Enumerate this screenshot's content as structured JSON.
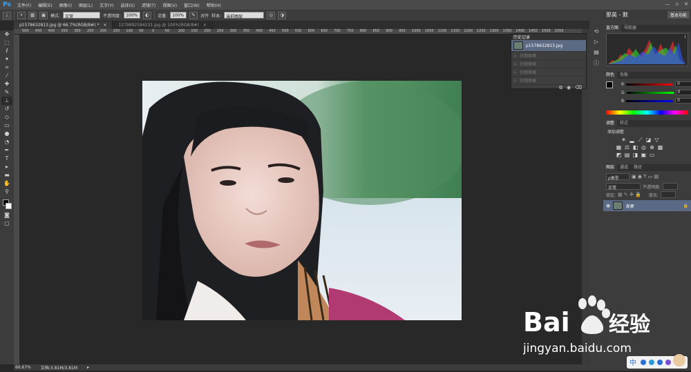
{
  "app": {
    "logo": "Ps"
  },
  "menu": [
    "文件(F)",
    "编辑(E)",
    "图像(I)",
    "图层(L)",
    "文字(Y)",
    "选择(S)",
    "滤镜(T)",
    "视图(V)",
    "窗口(W)",
    "帮助(H)"
  ],
  "window_controls": {
    "minimize": "—",
    "maximize": "▫",
    "close": "✕"
  },
  "options": {
    "mode_label": "模式:",
    "mode_value": "正常",
    "opacity_label": "不透明度:",
    "opacity_value": "100%",
    "flow_label": "流量:",
    "flow_value": "100%",
    "align_label": "对齐",
    "sample_label": "样本:",
    "sample_value": "当前图层"
  },
  "tabs": [
    {
      "label": "p1578632813.jpg @ 66.7%(RGB/8#) *",
      "close": "×"
    },
    {
      "label": "1279892594231.jpg @ 100%(RGB/8#)",
      "close": "×"
    }
  ],
  "ruler_ticks": [
    "500",
    "450",
    "400",
    "350",
    "300",
    "250",
    "200",
    "150",
    "100",
    "50",
    "0",
    "50",
    "100",
    "150",
    "200",
    "250",
    "300",
    "350",
    "400",
    "450",
    "500",
    "550",
    "600",
    "650",
    "700",
    "750",
    "800",
    "850",
    "900",
    "950",
    "1000",
    "1050",
    "1100",
    "1150",
    "1200",
    "1250",
    "1300",
    "1350",
    "1400",
    "1450",
    "1500",
    "1550"
  ],
  "status": {
    "zoom": "66.67%",
    "doc": "文档:3.81M/3.81M",
    "arrow": "▸"
  },
  "history": {
    "title": "历史记录",
    "snapshot": "p1578632813.jpg",
    "items": [
      "仿制图章",
      "仿制图章",
      "仿制图章",
      "仿制图章"
    ]
  },
  "right": {
    "workspace_title": "那英 - 默",
    "essentials": "基本功能",
    "histogram_tabs": [
      "直方图",
      "导航器"
    ],
    "histogram_warning": "!",
    "color_tabs": [
      "颜色",
      "色板"
    ],
    "colors": {
      "r": "R",
      "g": "G",
      "b": "B",
      "r_val": "0",
      "g_val": "0",
      "b_val": "0"
    },
    "adjust_tabs": [
      "调整",
      "样式"
    ],
    "adjust_title": "添加调整",
    "layers_tabs": [
      "图层",
      "通道",
      "路径"
    ],
    "kind_label": "ρ类型",
    "blend": "正常",
    "opacity_label": "不透明度:",
    "lock_label": "锁定:",
    "fill_label": "填充:",
    "layer_name": "背景"
  },
  "watermark": {
    "brand": "Bai",
    "brand2": "经验",
    "url": "jingyan.baidu.com",
    "badge": "中"
  }
}
